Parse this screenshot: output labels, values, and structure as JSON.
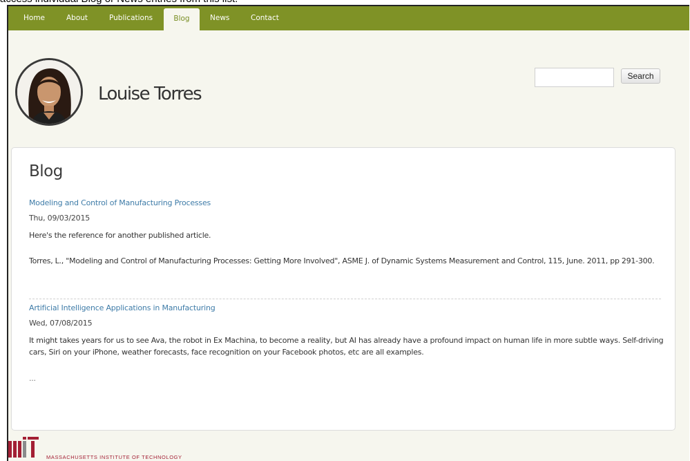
{
  "caption": "access individual Blog or News entries from this list.",
  "nav": {
    "items": [
      {
        "label": "Home"
      },
      {
        "label": "About"
      },
      {
        "label": "Publications"
      },
      {
        "label": "Blog"
      },
      {
        "label": "News"
      },
      {
        "label": "Contact"
      }
    ],
    "active": "Blog"
  },
  "header": {
    "site_name": "Louise Torres",
    "search": {
      "value": "",
      "button_label": "Search"
    }
  },
  "main": {
    "page_title": "Blog",
    "posts": [
      {
        "title": "Modeling and Control of Manufacturing Processes",
        "date": "Thu, 09/03/2015",
        "paragraphs": [
          "Here's the reference for another published article.",
          "Torres, L., \"Modeling and Control of Manufacturing Processes: Getting More Involved\", ASME J. of Dynamic Systems Measurement and Control, 115, June. 2011, pp 291-300."
        ]
      },
      {
        "title": "Artificial Intelligence Applications in Manufacturing",
        "date": "Wed, 07/08/2015",
        "paragraphs": [
          "It might takes years for us to see Ava, the robot in Ex Machina, to become a reality, but AI has already have a profound impact on human life in more subtle ways. Self-driving cars, Siri on your iPhone, weather forecasts, face recognition on your Facebook photos, etc are all examples.",
          "..."
        ]
      }
    ]
  },
  "footer": {
    "logo_text": "MASSACHUSETTS INSTITUTE OF TECHNOLOGY",
    "logo_color": "#a31f34"
  },
  "colors": {
    "nav_bg": "#7f9226",
    "link": "#3f7ca8",
    "page_bg": "#f6f6ee"
  }
}
